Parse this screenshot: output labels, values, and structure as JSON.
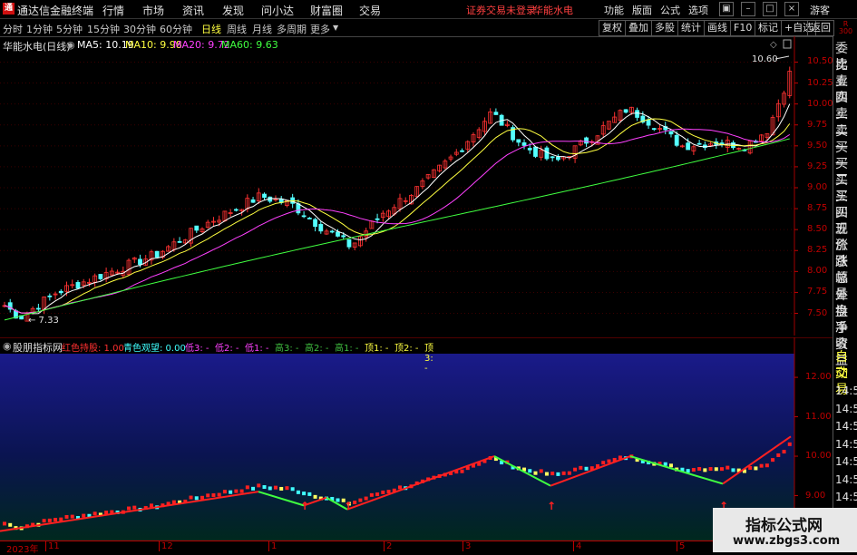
{
  "app": {
    "title": "通达信金融终端",
    "warning": "证券交易未登录",
    "stock_name_top": "华能水电",
    "user": "游客"
  },
  "menu": {
    "items": [
      "行情",
      "市场",
      "资讯",
      "发现",
      "问小达",
      "财富圈",
      "交易"
    ],
    "right": [
      "功能",
      "版面",
      "公式",
      "选项"
    ]
  },
  "toolbar": {
    "periods": [
      "分时",
      "1分钟",
      "5分钟",
      "15分钟",
      "30分钟",
      "60分钟",
      "日线",
      "周线",
      "月线",
      "多周期",
      "更多"
    ],
    "active": "日线",
    "right": [
      "复权",
      "叠加",
      "多股",
      "统计",
      "画线",
      "F10",
      "标记",
      "+自选",
      "返回"
    ]
  },
  "main_chart": {
    "title": "华能水电(日线)",
    "ma": [
      {
        "label": "MA5: 10.19",
        "color": "#ffffff"
      },
      {
        "label": "MA10: 9.98",
        "color": "#ffff40"
      },
      {
        "label": "MA20: 9.72",
        "color": "#ff40ff"
      },
      {
        "label": "MA60: 9.63",
        "color": "#40ff40"
      }
    ],
    "price_ticks": [
      "10.50",
      "10.25",
      "10.00",
      "9.75",
      "9.50",
      "9.25",
      "9.00",
      "8.75",
      "8.50",
      "8.25",
      "8.00",
      "7.75",
      "7.50"
    ],
    "high_label": "10.60",
    "low_label": "7.33",
    "ylim": [
      7.3,
      10.7
    ]
  },
  "indicator": {
    "title": "股朋指标网",
    "items": [
      {
        "label": "红色持股: 1.00",
        "color": "#ff3030"
      },
      {
        "label": "青色观望: 0.00",
        "color": "#40ffff"
      },
      {
        "label": "低3: -",
        "color": "#ff40ff"
      },
      {
        "label": "低2: -",
        "color": "#ff40ff"
      },
      {
        "label": "低1: -",
        "color": "#ff40ff"
      },
      {
        "label": "高3: -",
        "color": "#40c040"
      },
      {
        "label": "高2: -",
        "color": "#40c040"
      },
      {
        "label": "高1: -",
        "color": "#40c040"
      },
      {
        "label": "顶1: -",
        "color": "#ffff40"
      },
      {
        "label": "顶2: -",
        "color": "#ffff40"
      },
      {
        "label": "顶3: -",
        "color": "#ffff40"
      }
    ],
    "ticks": [
      "12.00",
      "11.00",
      "10.00",
      "9.00"
    ]
  },
  "date_axis": [
    "2023年",
    "11",
    "12",
    "1",
    "2",
    "3",
    "4",
    "5"
  ],
  "right_panel": {
    "items": [
      "委比",
      "卖五",
      "卖四",
      "卖三",
      "卖二",
      "卖一",
      "买一",
      "买二",
      "买三",
      "买四",
      "买五",
      "现价",
      "涨跌",
      "涨幅",
      "总量",
      "外盘",
      "换手",
      "净资",
      "收益"
    ],
    "bottom": [
      "自动",
      "交易"
    ],
    "times": [
      "14:56",
      "14:56",
      "14:56",
      "14:56",
      "14:56",
      "14:56",
      "14:56",
      "14:5"
    ]
  },
  "watermark": {
    "line1": "指标公式网",
    "line2": "www.zbgs3.com"
  }
}
